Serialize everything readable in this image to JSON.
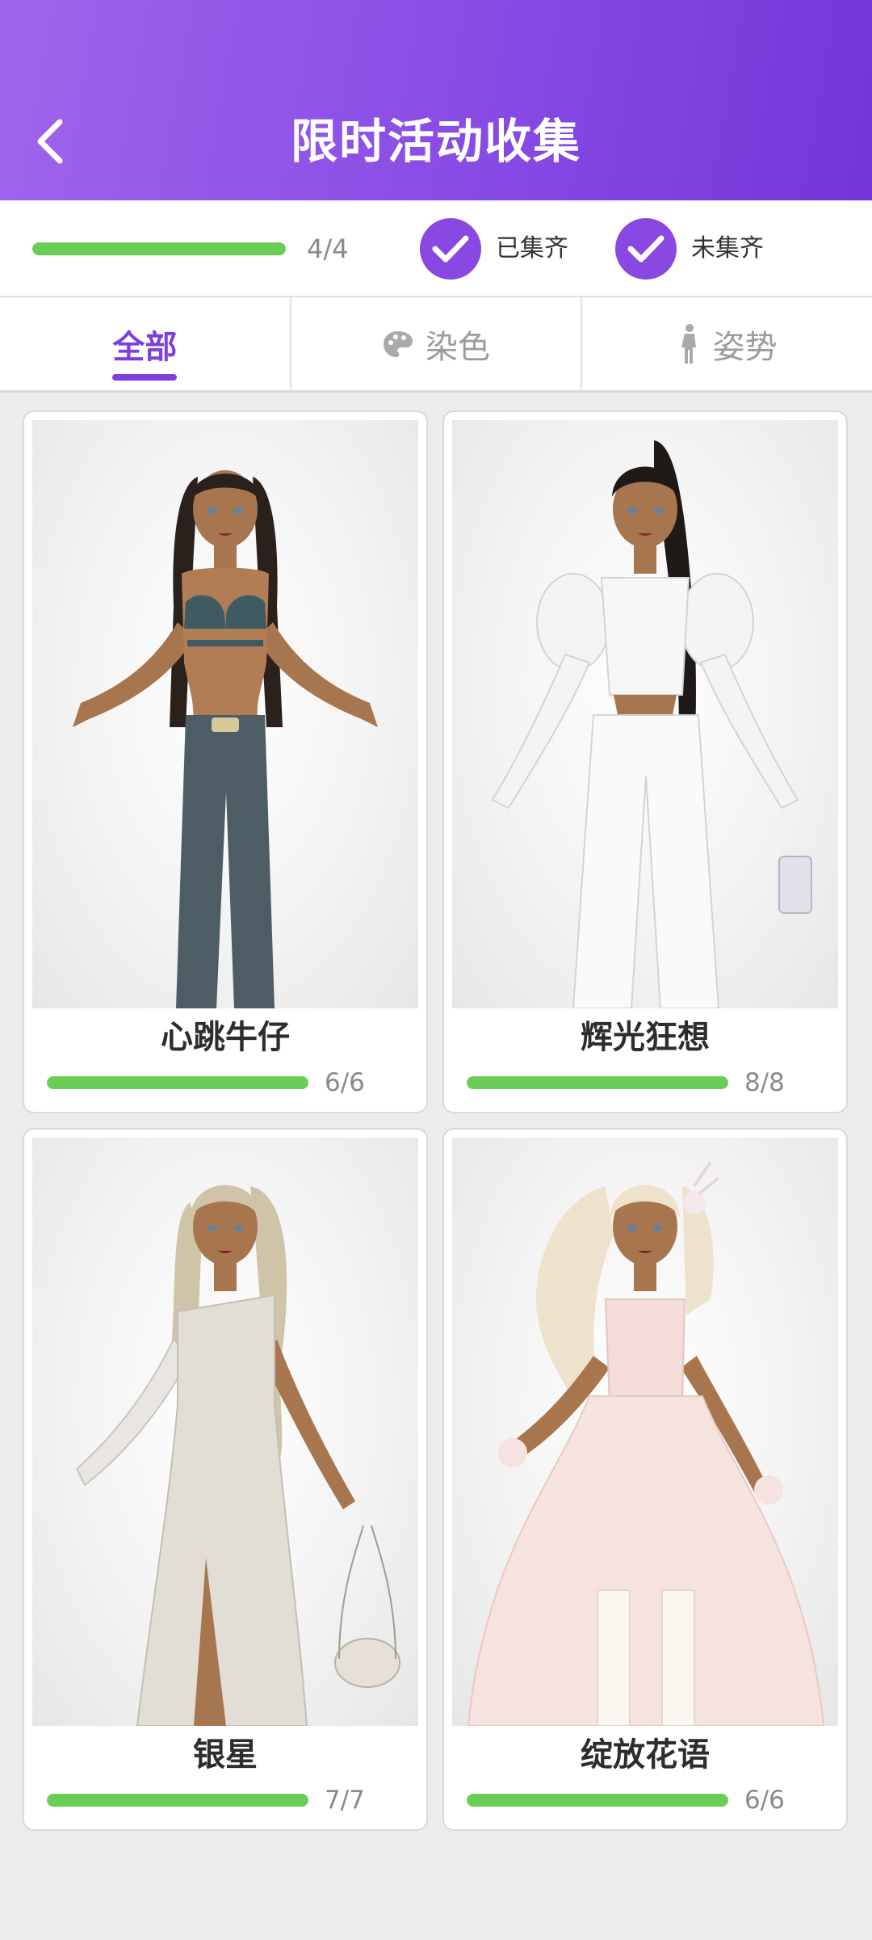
{
  "header": {
    "title": "限时活动收集"
  },
  "summary": {
    "progress_text": "4/4",
    "progress_fraction": 1.0,
    "filters": [
      {
        "label": "已集齐",
        "checked": true
      },
      {
        "label": "未集齐",
        "checked": true
      }
    ]
  },
  "tabs": [
    {
      "label": "全部",
      "icon": "",
      "active": true
    },
    {
      "label": "染色",
      "icon": "palette-icon",
      "active": false
    },
    {
      "label": "姿势",
      "icon": "person-pose-icon",
      "active": false
    }
  ],
  "collections": [
    {
      "name": "心跳牛仔",
      "count": "6/6",
      "fraction": 1.0,
      "image": "denim-outfit-character"
    },
    {
      "name": "辉光狂想",
      "count": "8/8",
      "fraction": 1.0,
      "image": "white-lace-outfit-character"
    },
    {
      "name": "银星",
      "count": "7/7",
      "fraction": 1.0,
      "image": "silver-gown-character"
    },
    {
      "name": "绽放花语",
      "count": "6/6",
      "fraction": 1.0,
      "image": "pink-floral-gown-character"
    }
  ],
  "colors": {
    "accent": "#7e3fdc",
    "progress": "#6acd56",
    "header_start": "#a064ec",
    "header_end": "#7434d8"
  }
}
